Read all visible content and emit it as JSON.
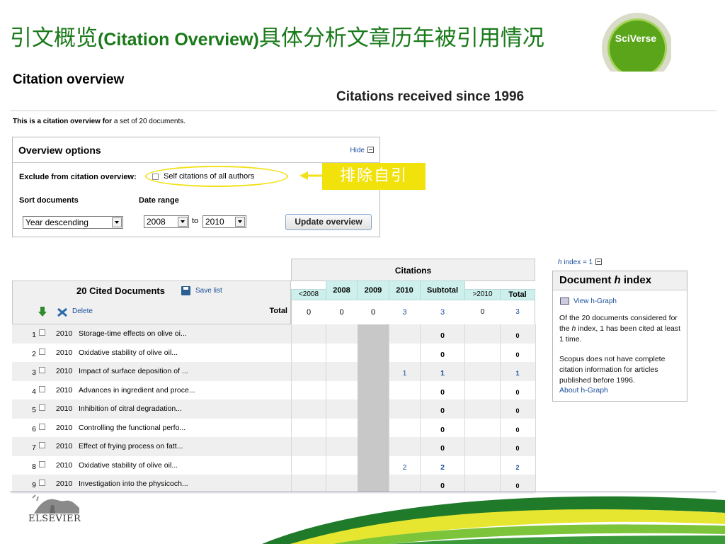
{
  "slide": {
    "title_zh1": "引文概览",
    "title_en": "(Citation Overview)",
    "title_zh2": "具体分析文章历年被引用情况",
    "badge_text": "SciVerse"
  },
  "page": {
    "heading": "Citation overview",
    "since_heading": "Citations received since 1996",
    "intro_bold": "This is a citation overview for",
    "intro_rest": " a set of 20 documents."
  },
  "overview_options": {
    "title": "Overview options",
    "hide_label": "Hide",
    "exclude_label": "Exclude from citation overview:",
    "self_citations_label": "Self citations of all authors",
    "sort_label": "Sort documents",
    "date_label": "Date range",
    "sort_value": "Year descending",
    "from_value": "2008",
    "to_label": "to",
    "to_value": "2010",
    "update_label": "Update overview"
  },
  "annotation": {
    "note": "排除自引"
  },
  "hindex": {
    "link_h": "h",
    "link_rest": " index = 1",
    "title_prefix": "Document ",
    "title_h": "h",
    "title_suffix": " index",
    "view_graph": "View h-Graph",
    "text1_a": "Of the 20 documents considered for the ",
    "text1_h": "h",
    "text1_b": " index, 1 has been cited at least 1 time.",
    "text2": "Scopus does not have complete citation information for articles published before 1996.",
    "about_link": "About h-Graph"
  },
  "table": {
    "cited_title": "20 Cited Documents",
    "save_list": "Save list",
    "delete_label": "Delete",
    "total_label": "Total",
    "citations_label": "Citations",
    "col_lt2008": "<2008",
    "col_2008": "2008",
    "col_2009": "2009",
    "col_2010": "2010",
    "col_subtotal": "Subtotal",
    "col_gt2010": ">2010",
    "col_total": "Total",
    "totals": {
      "lt2008": "0",
      "y2008": "0",
      "y2009": "0",
      "y2010": "3",
      "subtotal": "3",
      "gt2010": "0",
      "total": "3"
    },
    "rows": [
      {
        "num": "1",
        "year": "2010",
        "title": "Storage-time effects on olive oi...",
        "y2010": "",
        "subtotal": "0",
        "total": "0"
      },
      {
        "num": "2",
        "year": "2010",
        "title": "Oxidative stability of olive oil...",
        "y2010": "",
        "subtotal": "0",
        "total": "0"
      },
      {
        "num": "3",
        "year": "2010",
        "title": "Impact of surface deposition of ...",
        "y2010": "1",
        "subtotal": "1",
        "total": "1"
      },
      {
        "num": "4",
        "year": "2010",
        "title": "Advances in ingredient and proce...",
        "y2010": "",
        "subtotal": "0",
        "total": "0"
      },
      {
        "num": "5",
        "year": "2010",
        "title": "Inhibition of citral degradation...",
        "y2010": "",
        "subtotal": "0",
        "total": "0"
      },
      {
        "num": "6",
        "year": "2010",
        "title": "Controlling the functional perfo...",
        "y2010": "",
        "subtotal": "0",
        "total": "0"
      },
      {
        "num": "7",
        "year": "2010",
        "title": "Effect of frying process on fatt...",
        "y2010": "",
        "subtotal": "0",
        "total": "0"
      },
      {
        "num": "8",
        "year": "2010",
        "title": "Oxidative stability of olive oil...",
        "y2010": "2",
        "subtotal": "2",
        "total": "2"
      },
      {
        "num": "9",
        "year": "2010",
        "title": "Investigation into the physicoch...",
        "y2010": "",
        "subtotal": "0",
        "total": "0"
      }
    ]
  },
  "footer": {
    "publisher": "ELSEVIER"
  },
  "colors": {
    "title_green": "#1a7a1a",
    "link_blue": "#1a4f9c",
    "highlight_yellow": "#f2e20c",
    "header_cyan": "#cdf0ec"
  }
}
